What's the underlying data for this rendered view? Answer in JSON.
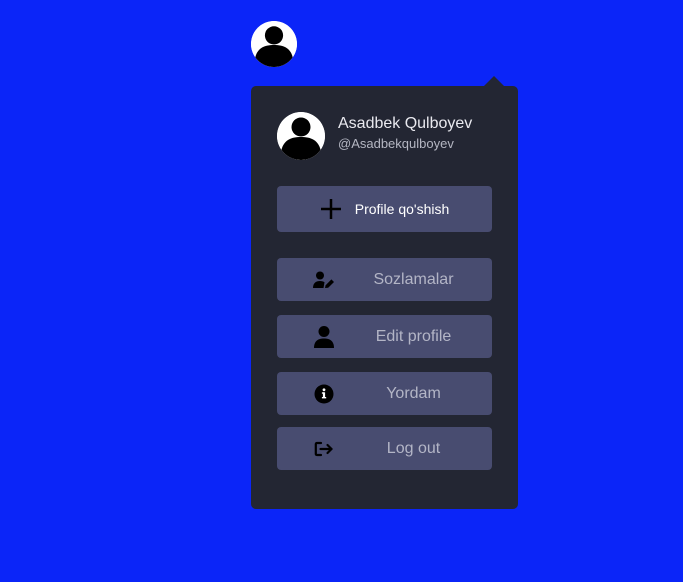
{
  "profile": {
    "name": "Asadbek Qulboyev",
    "handle": "@Asadbekqulboyev"
  },
  "add_profile_button": {
    "label": "Profile qo'shish",
    "icon": "plus-icon"
  },
  "menu_items": [
    {
      "label": "Sozlamalar",
      "icon": "user-edit-icon"
    },
    {
      "label": "Edit profile",
      "icon": "user-icon"
    },
    {
      "label": "Yordam",
      "icon": "info-circle-icon"
    },
    {
      "label": "Log out",
      "icon": "logout-icon"
    }
  ],
  "colors": {
    "page_background": "#0b25f8",
    "menu_background": "#232633",
    "button_background": "#484c70",
    "item_text": "#b3b5c6"
  }
}
